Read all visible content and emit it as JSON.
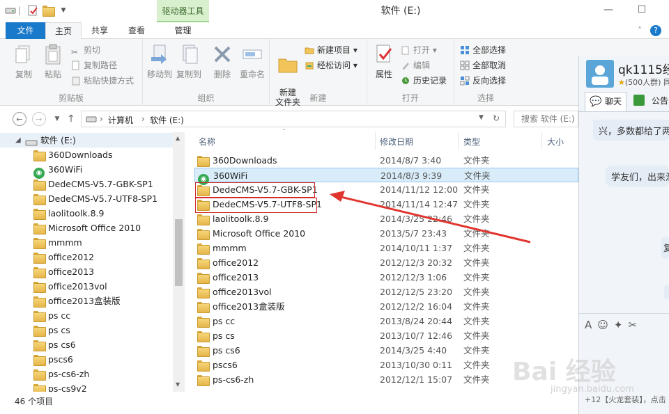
{
  "window": {
    "title": "软件 (E:)",
    "context_tab": "驱动器工具"
  },
  "tabs": {
    "file": "文件",
    "home": "主页",
    "share": "共享",
    "view": "查看",
    "manage": "管理"
  },
  "ribbon": {
    "clipboard": {
      "copy": "复制",
      "paste": "粘贴",
      "cut": "剪切",
      "copy_path": "复制路径",
      "paste_shortcut": "粘贴快捷方式",
      "label": "剪贴板"
    },
    "organize": {
      "move_to": "移动到",
      "copy_to": "复制到",
      "delete": "删除",
      "rename": "重命名",
      "label": "组织"
    },
    "new": {
      "new_folder": "新建\n文件夹",
      "new_item": "新建项目",
      "easy_access": "经松访问",
      "label": "新建"
    },
    "open": {
      "properties": "属性",
      "open": "打开",
      "edit": "编辑",
      "history": "历史记录",
      "label": "打开"
    },
    "select": {
      "select_all": "全部选择",
      "select_none": "全部取消",
      "invert": "反向选择",
      "label": "选择"
    }
  },
  "address": {
    "computer": "计算机",
    "drive": "软件 (E:)",
    "search_placeholder": "搜索 软件 (E:)"
  },
  "nav": {
    "root": "软件 (E:)",
    "items": [
      "360Downloads",
      "360WiFi",
      "DedeCMS-V5.7-GBK-SP1",
      "DedeCMS-V5.7-UTF8-SP1",
      "laolitoolk.8.9",
      "Microsoft Office 2010",
      "mmmm",
      "office2012",
      "office2013",
      "office2013vol",
      "office2013盒装版",
      "ps  cc",
      "ps  cs",
      "ps cs6",
      "pscs6",
      "ps-cs6-zh",
      "ps-cs9v2"
    ]
  },
  "columns": {
    "name": "名称",
    "modified": "修改日期",
    "type": "类型",
    "size": "大小"
  },
  "files": [
    {
      "name": "360Downloads",
      "date": "2014/8/7 3:40",
      "type": "文件夹"
    },
    {
      "name": "360WiFi",
      "date": "2014/8/3 9:39",
      "type": "文件夹"
    },
    {
      "name": "DedeCMS-V5.7-GBK-SP1",
      "date": "2014/11/12 12:00",
      "type": "文件夹"
    },
    {
      "name": "DedeCMS-V5.7-UTF8-SP1",
      "date": "2014/11/14 12:47",
      "type": "文件夹"
    },
    {
      "name": "laolitoolk.8.9",
      "date": "2014/3/25 22:46",
      "type": "文件夹"
    },
    {
      "name": "Microsoft Office 2010",
      "date": "2013/5/7 23:43",
      "type": "文件夹"
    },
    {
      "name": "mmmm",
      "date": "2014/10/11 1:37",
      "type": "文件夹"
    },
    {
      "name": "office2012",
      "date": "2012/12/3 20:32",
      "type": "文件夹"
    },
    {
      "name": "office2013",
      "date": "2012/12/3 1:06",
      "type": "文件夹"
    },
    {
      "name": "office2013vol",
      "date": "2012/12/5 23:20",
      "type": "文件夹"
    },
    {
      "name": "office2013盒装版",
      "date": "2012/12/2 16:04",
      "type": "文件夹"
    },
    {
      "name": "ps  cc",
      "date": "2013/8/24 20:44",
      "type": "文件夹"
    },
    {
      "name": "ps  cs",
      "date": "2013/10/7 12:46",
      "type": "文件夹"
    },
    {
      "name": "ps cs6",
      "date": "2014/3/25 4:40",
      "type": "文件夹"
    },
    {
      "name": "pscs6",
      "date": "2013/10/30 0:11",
      "type": "文件夹"
    },
    {
      "name": "ps-cs6-zh",
      "date": "2012/12/1 15:07",
      "type": "文件夹"
    }
  ],
  "status": {
    "count": "46 个项目"
  },
  "chat": {
    "group_name": "qk1115经",
    "group_meta": "(500人群) 同",
    "tab_chat": "聊天",
    "tab_notice": "公告",
    "msg1": "兴，多数都给了两",
    "msg2": "学友们，出来溜",
    "msg3": "复",
    "footer": "+12【火龙套装】，点击"
  },
  "watermark": {
    "brand": "Bai 经验",
    "url": "jingyan.baidu.com"
  },
  "colors": {
    "accent": "#1979ca",
    "highlight_box": "#d02a2a",
    "selected_row": "#d9ecfa"
  }
}
